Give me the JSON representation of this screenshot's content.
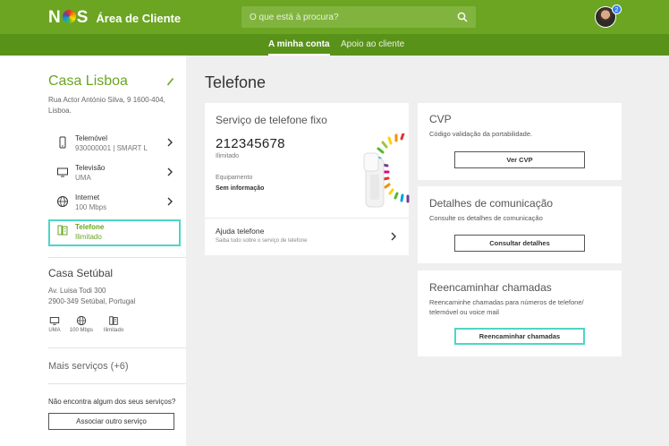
{
  "header": {
    "brand": "NS",
    "brand_left": "N",
    "brand_right": "S",
    "title": "Área de Cliente",
    "search_placeholder": "O que está à procura?",
    "notification_count": "2",
    "brand_color": "#6ba522"
  },
  "nav": {
    "tabs": [
      {
        "label": "A minha conta",
        "active": true
      },
      {
        "label": "Apoio ao cliente",
        "active": false
      }
    ]
  },
  "sidebar": {
    "location1": {
      "title": "Casa Lisboa",
      "address": "Rua Actor António Silva, 9 1600-404, Lisboa.",
      "services": [
        {
          "name": "Telemóvel",
          "detail": "930000001 | SMART L",
          "icon": "mobile-phone-icon"
        },
        {
          "name": "Televisão",
          "detail": "UMA",
          "icon": "tv-icon"
        },
        {
          "name": "Internet",
          "detail": "100 Mbps",
          "icon": "globe-icon"
        },
        {
          "name": "Telefone",
          "detail": "Ilimitado",
          "icon": "landline-phone-icon",
          "selected": true
        }
      ]
    },
    "location2": {
      "title": "Casa Setúbal",
      "address_line1": "Av. Luisa Todi 300",
      "address_line2": "2900-349 Setúbal, Portugal",
      "services": [
        {
          "label": "UMA",
          "icon": "tv-icon"
        },
        {
          "label": "100 Mbps",
          "icon": "globe-icon"
        },
        {
          "label": "Ilimitado",
          "icon": "landline-phone-icon"
        }
      ]
    },
    "more_services": "Mais serviços (+6)",
    "not_found_text": "Não encontra algum dos seus serviços?",
    "associate_button": "Associar outro serviço"
  },
  "main": {
    "page_title": "Telefone",
    "fixed_phone_card": {
      "title": "Serviço de telefone fixo",
      "number": "212345678",
      "plan": "Ilimitado",
      "equipment_label": "Equipamento",
      "equipment_value": "Sem informação",
      "help_title": "Ajuda telefone",
      "help_subtitle": "Saiba tudo sobre o serviço de telefone"
    },
    "cvp_card": {
      "title": "CVP",
      "description": "Código validação da portabilidade.",
      "button": "Ver CVP"
    },
    "communication_card": {
      "title": "Detalhes de comunicação",
      "description": "Consulte os detalhes de comunicação",
      "button": "Consultar detalhes"
    },
    "forward_card": {
      "title": "Reencaminhar chamadas",
      "description_line1": "Reencaminhe chamadas para números de telefone/",
      "description_line2": "telemóvel ou voice mail",
      "button": "Reencaminhar chamadas"
    },
    "highlight_color": "#4dd5c6"
  }
}
